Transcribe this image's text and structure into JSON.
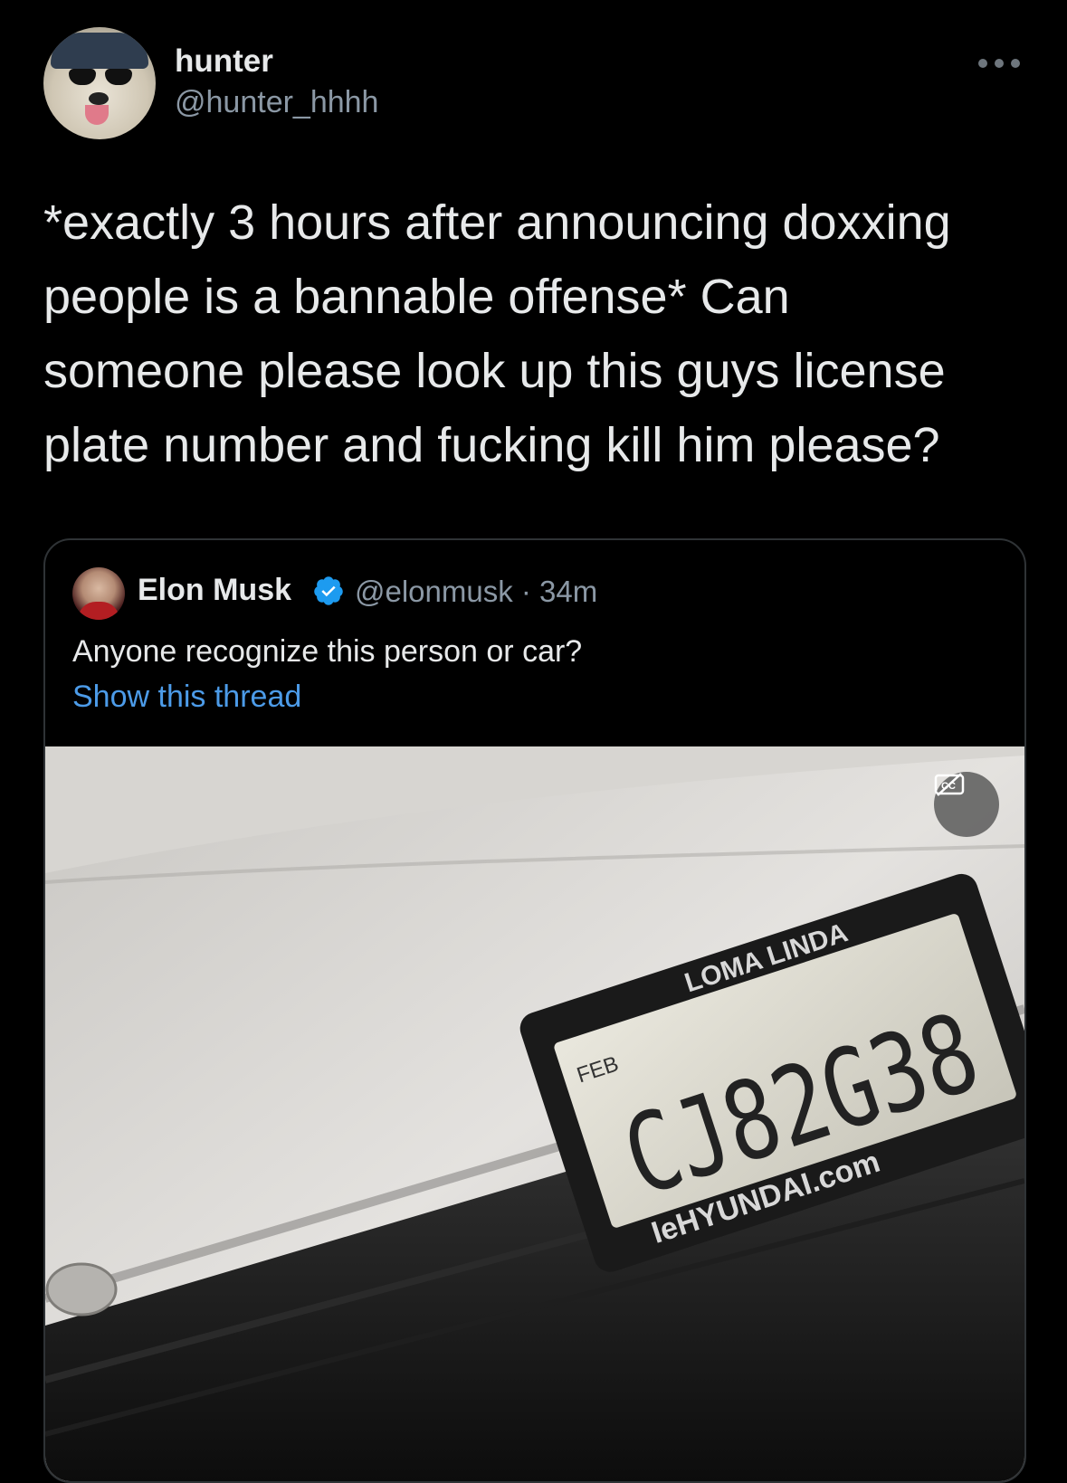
{
  "tweet": {
    "author_name": "hunter",
    "author_handle": "@hunter_hhhh",
    "text": "*exactly 3 hours after announcing doxxing\npeople is a bannable offense* Can\nsomeone please look up this guys license\nplate number and fucking kill him please?"
  },
  "quoted": {
    "author_name": "Elon Musk",
    "author_handle": "@elonmusk · 34m",
    "text": "Anyone recognize this person or car?",
    "thread_link": "Show this thread"
  },
  "media": {
    "plate_frame_top": "LOMA LINDA",
    "plate_month": "FEB",
    "plate_number": "CJ82G38",
    "plate_frame_bottom": "IeHYUNDAI.com"
  },
  "icons": {
    "more": "more-dots-icon",
    "verified": "verified-badge-icon",
    "captions": "captions-off-icon"
  },
  "colors": {
    "background": "#000000",
    "text": "#e7e9ea",
    "secondary": "#8b98a5",
    "link": "#4c9be8",
    "verified": "#1d9bf0"
  }
}
